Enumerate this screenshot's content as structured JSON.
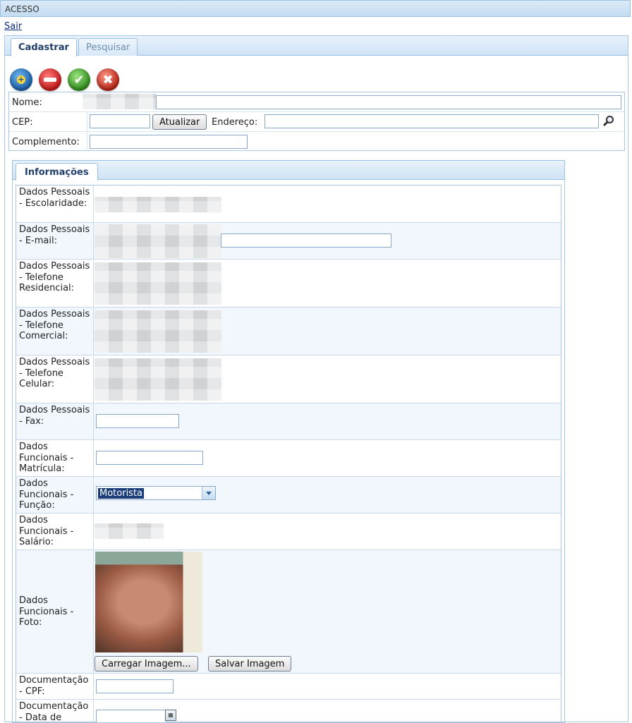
{
  "window": {
    "title": "ACESSO"
  },
  "header": {
    "logout_label": "Sair"
  },
  "tabs": [
    {
      "label": "Cadastrar",
      "active": true
    },
    {
      "label": "Pesquisar",
      "active": false
    }
  ],
  "toolbar": {
    "icons": [
      "add-icon",
      "remove-icon",
      "confirm-icon",
      "cancel-icon"
    ]
  },
  "form": {
    "nome_label": "Nome:",
    "cep_label": "CEP:",
    "atualizar_label": "Atualizar",
    "endereco_label": "Endereço:",
    "complemento_label": "Complemento:"
  },
  "info_tab": {
    "label": "Informações"
  },
  "rows": {
    "escolaridade": "Dados Pessoais - Escolaridade:",
    "email": "Dados Pessoais - E-mail:",
    "tel_residencial": "Dados Pessoais - Telefone Residencial:",
    "tel_comercial": "Dados Pessoais - Telefone Comercial:",
    "tel_celular": "Dados Pessoais - Telefone Celular:",
    "fax": "Dados Pessoais - Fax:",
    "matricula": "Dados Funcionais - Matrícula:",
    "funcao": "Dados Funcionais - Função:",
    "salario": "Dados Funcionais - Salário:",
    "foto": "Dados Funcionais - Foto:",
    "cpf": "Documentação - CPF:",
    "data": "Documentação - Data de"
  },
  "funcao_value": "Motorista",
  "photo_buttons": {
    "load_label": "Carregar Imagem...",
    "save_label": "Salvar Imagem"
  }
}
